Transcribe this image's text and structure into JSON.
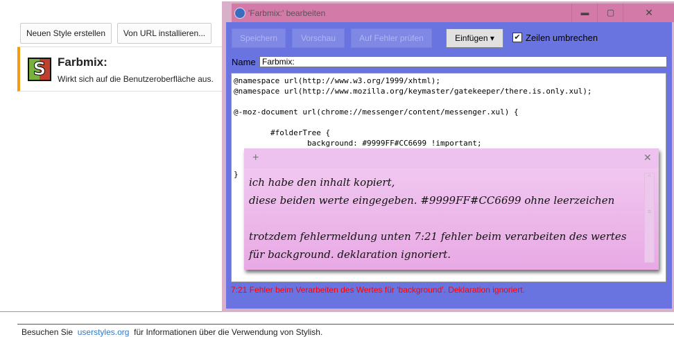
{
  "manager": {
    "new_style": "Neuen Style erstellen",
    "install_url": "Von URL installieren...",
    "style_name": "Farbmix:",
    "style_desc": "Wirkt sich auf die Benutzeroberfläche aus."
  },
  "footer": {
    "pre": "Besuchen Sie",
    "link": "userstyles.org",
    "post": "für Informationen über die Verwendung von Stylish."
  },
  "editor": {
    "title": "'Farbmix:' bearbeiten",
    "save": "Speichern",
    "preview": "Vorschau",
    "check": "Auf Fehler prüfen",
    "insert": "Einfügen",
    "wrap_label": "Zeilen umbrechen",
    "wrap_checked": true,
    "name_label": "Name",
    "name_value": "Farbmix:",
    "code": "@namespace url(http://www.w3.org/1999/xhtml);\n@namespace url(http://www.mozilla.org/keymaster/gatekeeper/there.is.only.xul);\n\n@-moz-document url(chrome://messenger/content/messenger.xul) {\n\n        #folderTree {\n                background: #9999FF#CC6699 !important;\n        }\n\n}",
    "error": "7:21 Fehler beim Verarbeiten des Wertes für 'background'. Deklaration ignoriert."
  },
  "note": {
    "lines": [
      "ich habe den inhalt kopiert,",
      "diese beiden werte eingegeben. #9999FF#CC6699 ohne leerzeichen",
      "",
      "trotzdem fehlermeldung unten 7:21 fehler beim verarbeiten des wertes",
      "für background. deklaration ignoriert."
    ]
  },
  "colors": {
    "title": "#d47aa8",
    "body": "#6a74e0",
    "note": "#f0c4ee",
    "error": "#ff0000",
    "accent": "#f39c12"
  }
}
